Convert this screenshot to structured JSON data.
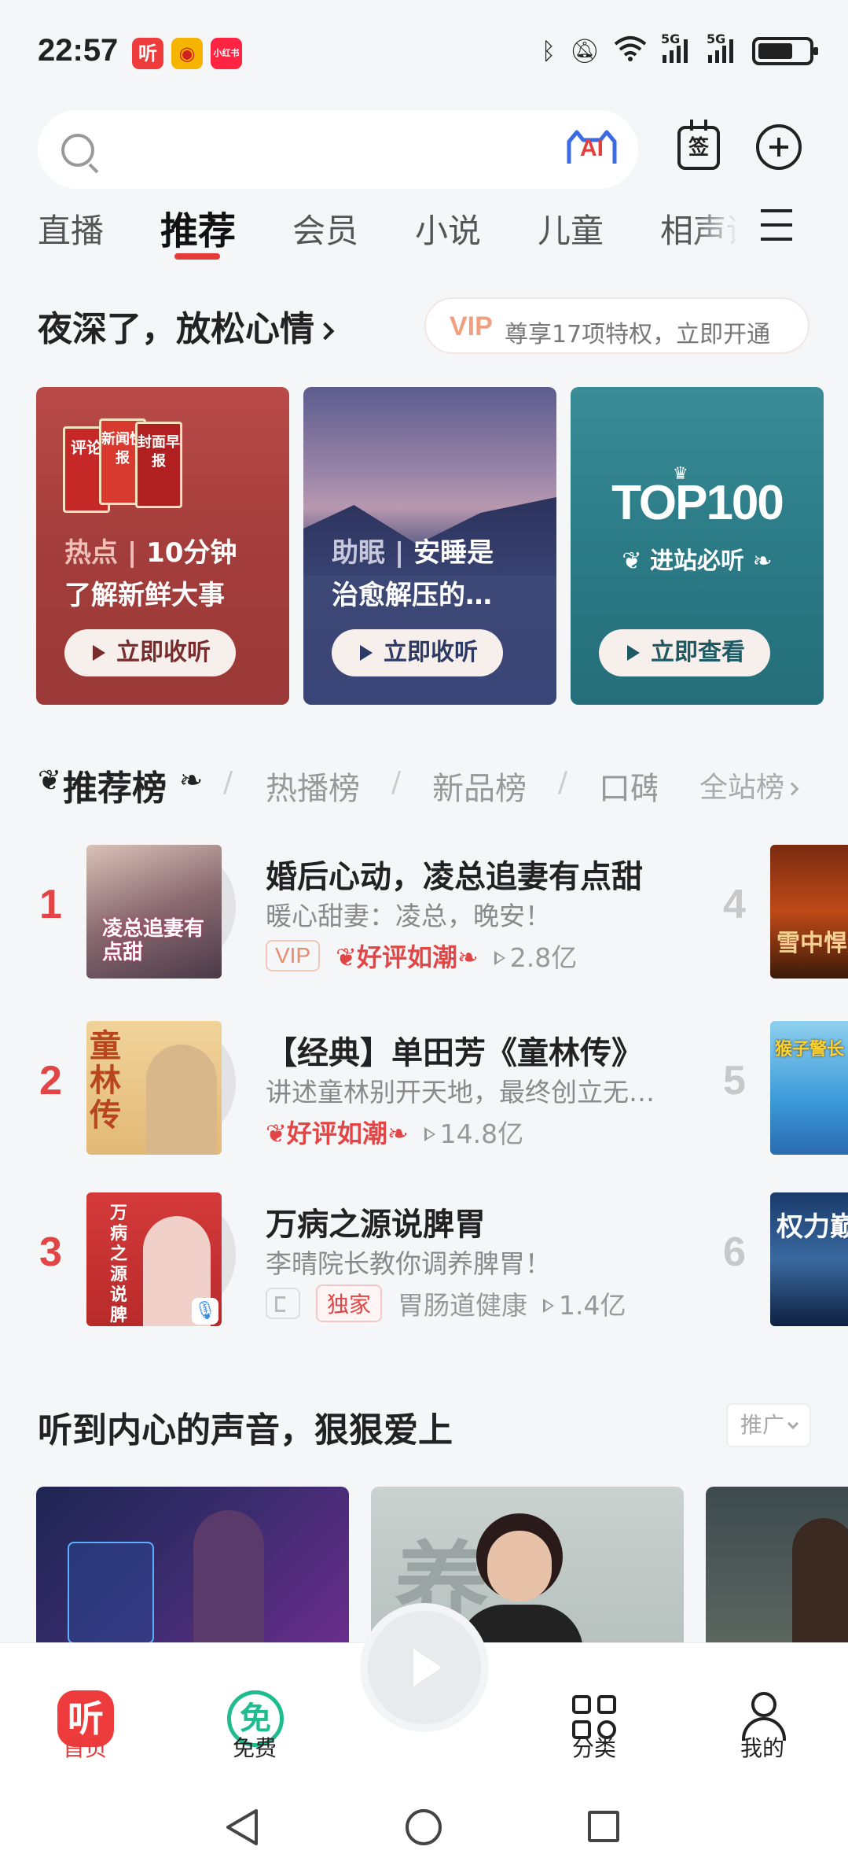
{
  "status_bar": {
    "time": "22:57",
    "apps": [
      {
        "icon": "ximalaya-app-icon",
        "glyph": "听",
        "color": "#ee3b3b"
      },
      {
        "icon": "weibo-app-icon",
        "glyph": "◉",
        "color": "#f5b400"
      },
      {
        "icon": "xiaohongshu-app-icon",
        "glyph": "小红书",
        "color": "#ff2442"
      }
    ],
    "signal_labels": [
      "5G",
      "5G"
    ]
  },
  "search": {
    "placeholder": "",
    "ai_label": "AI",
    "sign_label": "签"
  },
  "tabs": [
    {
      "label": "直播",
      "active": false
    },
    {
      "label": "推荐",
      "active": true
    },
    {
      "label": "会员",
      "active": false
    },
    {
      "label": "小说",
      "active": false
    },
    {
      "label": "儿童",
      "active": false
    },
    {
      "label": "相声评",
      "active": false
    }
  ],
  "headline": {
    "title": "夜深了，放松心情",
    "vip_tag": "VIP",
    "vip_text": "尊享17项特权，立即开通"
  },
  "cards": [
    {
      "tag": "热点",
      "sep": "|",
      "line1": "10分钟",
      "line2": "了解新鲜大事",
      "button": "立即收听",
      "books": [
        "评论",
        "新闻快报",
        "封面早报"
      ]
    },
    {
      "tag": "助眠",
      "sep": "|",
      "line1": "安睡是",
      "line2": "治愈解压的…",
      "button": "立即收听"
    },
    {
      "title": "TOP100",
      "subtitle": "进站必听",
      "button": "立即查看"
    }
  ],
  "rank_tabs": {
    "active": "推荐榜",
    "items": [
      "热播榜",
      "新品榜",
      "口碑"
    ],
    "all": "全站榜"
  },
  "rank_list": [
    {
      "num": "1",
      "title": "婚后心动，凌总追妻有点甜",
      "subtitle": "暖心甜妻：凌总，晚安！",
      "vip": "VIP",
      "hot": "好评如潮",
      "plays": "2.8亿",
      "cover_text": "凌总追妻有点甜",
      "right_num": "4",
      "right_cover_text": "雪中悍刀"
    },
    {
      "num": "2",
      "title": "【经典】单田芳《童林传》",
      "subtitle": "讲述童林别开天地，最终创立无极门的故事",
      "hot": "好评如潮",
      "plays": "14.8亿",
      "cover_text": "童林传",
      "right_num": "5",
      "right_cover_text": "猴子警长"
    },
    {
      "num": "3",
      "title": "万病之源说脾胃",
      "subtitle": "李晴院长教你调养脾胃！",
      "exclusive": "独家",
      "category": "胃肠道健康",
      "plays": "1.4亿",
      "cover_text": "万病之源说脾胃",
      "right_num": "6",
      "right_cover_text": "权力巅"
    }
  ],
  "section2": {
    "title": "听到内心的声音，狠狠爱上",
    "ad_label": "推广"
  },
  "bottom_nav": {
    "home": "首页",
    "home_glyph": "听",
    "free": "免费",
    "free_glyph": "免",
    "category": "分类",
    "me": "我的"
  },
  "colors": {
    "accent": "#e63b3b",
    "free_green": "#1fbc8f"
  }
}
